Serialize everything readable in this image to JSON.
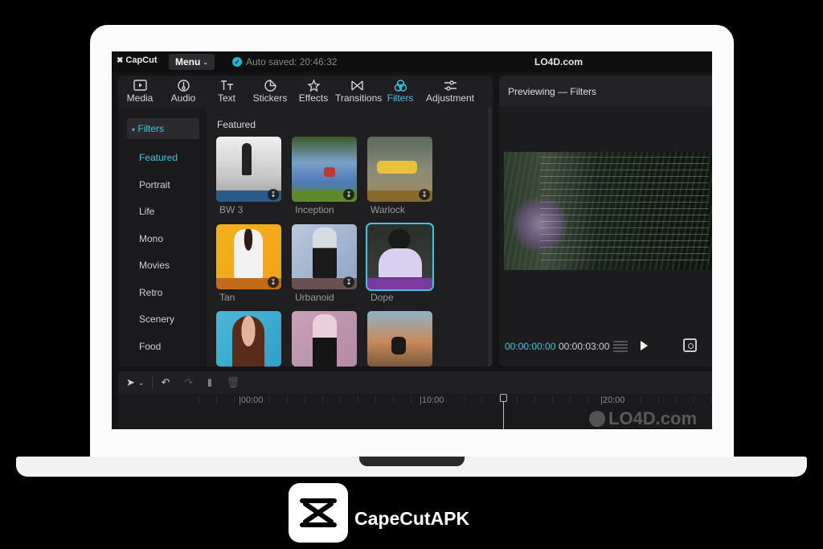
{
  "topbar": {
    "logo_text": "CapCut",
    "menu_label": "Menu",
    "autosave_text": "Auto saved: 20:46:32",
    "site_title": "LO4D.com"
  },
  "toolbar": [
    {
      "label": "Media",
      "icon": "media-icon"
    },
    {
      "label": "Audio",
      "icon": "audio-icon"
    },
    {
      "label": "Text",
      "icon": "text-icon"
    },
    {
      "label": "Stickers",
      "icon": "stickers-icon"
    },
    {
      "label": "Effects",
      "icon": "effects-icon"
    },
    {
      "label": "Transitions",
      "icon": "transitions-icon"
    },
    {
      "label": "Filters",
      "icon": "filters-icon",
      "active": true
    },
    {
      "label": "Adjustment",
      "icon": "adjustment-icon"
    }
  ],
  "sidebar": {
    "header": "Filters",
    "items": [
      "Featured",
      "Portrait",
      "Life",
      "Mono",
      "Movies",
      "Retro",
      "Scenery",
      "Food"
    ],
    "active": "Featured"
  },
  "content": {
    "section_title": "Featured",
    "tiles": [
      {
        "label": "BW 3",
        "band_color": "#2a5a8a"
      },
      {
        "label": "Inception",
        "band_color": "#5e8a2a"
      },
      {
        "label": "Warlock",
        "band_color": "#8a6a2a"
      },
      {
        "label": "Tan",
        "band_color": "#c06a1a"
      },
      {
        "label": "Urbanoid",
        "band_color": "#6a5050"
      },
      {
        "label": "Dope",
        "band_color": "#7a3aa0",
        "selected": true
      },
      {
        "label": "",
        "band_color": ""
      },
      {
        "label": "",
        "band_color": ""
      },
      {
        "label": "",
        "band_color": ""
      }
    ]
  },
  "preview": {
    "header": "Previewing — Filters",
    "timecode_current": "00:00:00:00",
    "timecode_total": "00:00:03:00"
  },
  "timeline": {
    "ruler_labels": [
      "|00:00",
      "|10:00",
      "|20:00"
    ],
    "watermark": "LO4D.com"
  },
  "brand": {
    "name": "CapeCutAPK"
  },
  "colors": {
    "accent": "#3ec6e4",
    "background": "#000000",
    "panel": "#1f1f22"
  }
}
